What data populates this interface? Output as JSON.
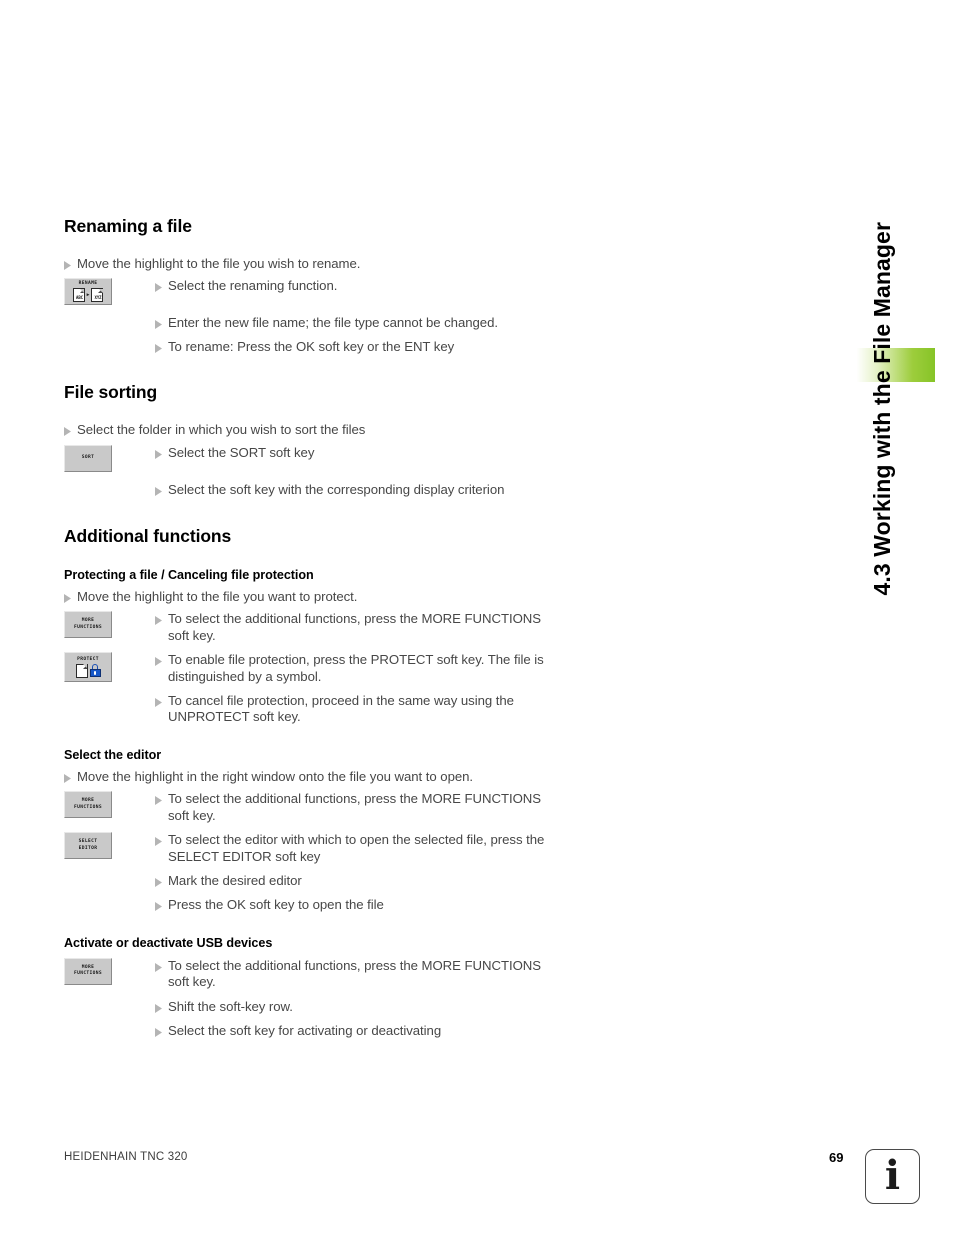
{
  "side_tab": {
    "title": "4.3 Working with the File Manager",
    "accent_color": "#8dc63f"
  },
  "sections": [
    {
      "id": "renaming-a-file",
      "heading": "Renaming a file",
      "steps": [
        {
          "level": 1,
          "text": "Move the highlight to the file you wish to rename."
        },
        {
          "level": 2,
          "text": "Select the renaming function.",
          "softkey": "rename"
        },
        {
          "level": 2,
          "text": "Enter the new file name; the file type cannot be changed."
        },
        {
          "level": 2,
          "text": "To rename: Press the OK soft key or the ENT key"
        }
      ]
    },
    {
      "id": "file-sorting",
      "heading": "File sorting",
      "steps": [
        {
          "level": 1,
          "text": "Select the folder in which you wish to sort the files"
        },
        {
          "level": 2,
          "text": "Select the SORT soft key",
          "softkey": "sort"
        },
        {
          "level": 2,
          "text": "Select the soft key with the corresponding display criterion"
        }
      ]
    },
    {
      "id": "additional-functions",
      "heading": "Additional functions",
      "subsections": [
        {
          "id": "protecting-a-file",
          "heading": "Protecting a file / Canceling file protection",
          "steps": [
            {
              "level": 1,
              "text": "Move the highlight to the file you want to protect."
            },
            {
              "level": 2,
              "text": "To select the additional functions, press the MORE FUNCTIONS soft key.",
              "softkey": "more_functions"
            },
            {
              "level": 2,
              "text": "To enable file protection, press the PROTECT soft key. The file is distinguished by a symbol.",
              "softkey": "protect"
            },
            {
              "level": 2,
              "text": "To cancel file protection, proceed in the same way using the UNPROTECT soft key."
            }
          ]
        },
        {
          "id": "select-the-editor",
          "heading": "Select the editor",
          "steps": [
            {
              "level": 1,
              "text": "Move the highlight in the right window onto the file you want to open."
            },
            {
              "level": 2,
              "text": "To select the additional functions, press the MORE FUNCTIONS soft key.",
              "softkey": "more_functions"
            },
            {
              "level": 2,
              "text": "To select the editor with which to open the selected file, press the SELECT EDITOR soft key",
              "softkey": "select_editor"
            },
            {
              "level": 2,
              "text": "Mark the desired editor"
            },
            {
              "level": 2,
              "text": "Press the OK soft key to open the file"
            }
          ]
        },
        {
          "id": "activate-usb-devices",
          "heading": "Activate or deactivate USB devices",
          "steps": [
            {
              "level": 2,
              "text": "To select the additional functions, press the MORE FUNCTIONS soft key.",
              "softkey": "more_functions"
            },
            {
              "level": 2,
              "text": "Shift the soft-key row."
            },
            {
              "level": 2,
              "text": "Select the soft key for activating or deactivating"
            }
          ]
        }
      ]
    }
  ],
  "softkeys": {
    "rename": {
      "label": "RENAME",
      "icon": "rename-icon",
      "icon_labels": [
        "ABC",
        "XYZ"
      ],
      "separator": "▸"
    },
    "sort": {
      "label": "SORT"
    },
    "more_functions": {
      "label_line1": "MORE",
      "label_line2": "FUNCTIONS"
    },
    "protect": {
      "label": "PROTECT",
      "icon": "protect-lock-icon"
    },
    "select_editor": {
      "label_line1": "SELECT",
      "label_line2": "EDITOR"
    }
  },
  "footer": {
    "product": "HEIDENHAIN TNC 320",
    "page_number": "69",
    "info_glyph": "i"
  }
}
